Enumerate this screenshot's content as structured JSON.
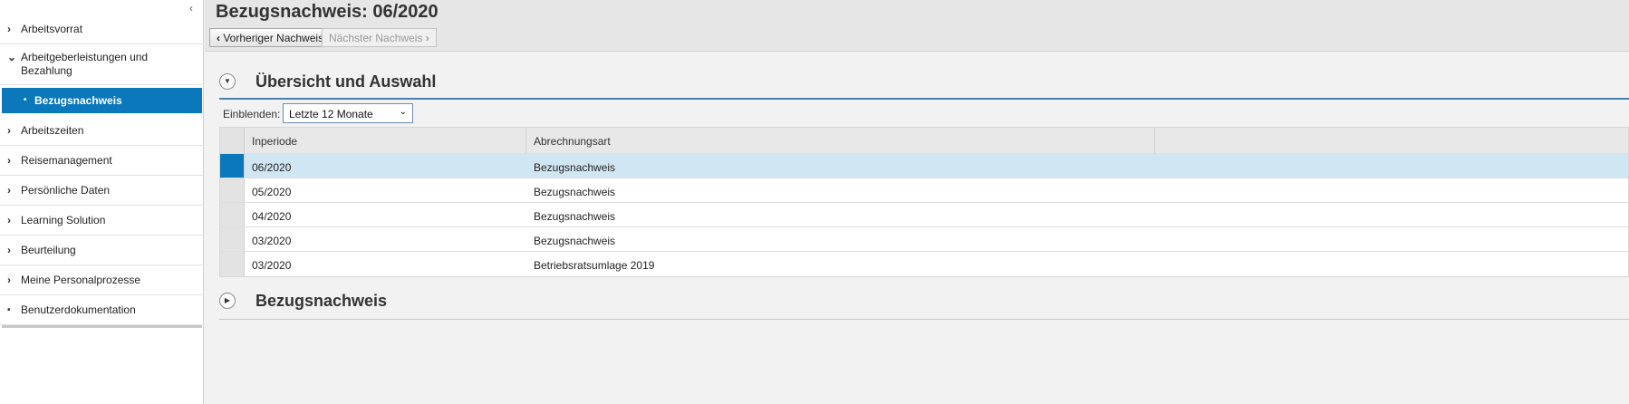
{
  "sidebar": {
    "collapse_icon": "chevron-left-icon",
    "items": [
      {
        "label": "Arbeitsvorrat",
        "icon": "chevron-right-icon"
      },
      {
        "label": "Arbeitgeberleistungen und Bezahlung",
        "icon": "chevron-down-icon"
      },
      {
        "label": "Arbeitszeiten",
        "icon": "chevron-right-icon"
      },
      {
        "label": "Reisemanagement",
        "icon": "chevron-right-icon"
      },
      {
        "label": "Persönliche Daten",
        "icon": "chevron-right-icon"
      },
      {
        "label": "Learning Solution",
        "icon": "chevron-right-icon"
      },
      {
        "label": "Beurteilung",
        "icon": "chevron-right-icon"
      },
      {
        "label": "Meine Personalprozesse",
        "icon": "chevron-right-icon"
      },
      {
        "label": "Benutzerdokumentation",
        "icon": "bullet-icon"
      }
    ],
    "subitem": {
      "label": "Bezugsnachweis",
      "icon": "bullet-icon"
    }
  },
  "header": {
    "title": "Bezugsnachweis: 06/2020",
    "prev_label": "Vorheriger Nachweis",
    "next_label": "Nächster Nachweis"
  },
  "overview": {
    "title": "Übersicht und Auswahl",
    "filter_label": "Einblenden:",
    "filter_value": "Letzte 12 Monate",
    "columns": [
      "Inperiode",
      "Abrechnungsart"
    ],
    "rows": [
      {
        "period": "06/2020",
        "type": "Bezugsnachweis",
        "selected": true
      },
      {
        "period": "05/2020",
        "type": "Bezugsnachweis",
        "selected": false
      },
      {
        "period": "04/2020",
        "type": "Bezugsnachweis",
        "selected": false
      },
      {
        "period": "03/2020",
        "type": "Bezugsnachweis",
        "selected": false
      },
      {
        "period": "03/2020",
        "type": "Betriebsratsumlage 2019",
        "selected": false
      }
    ]
  },
  "detail": {
    "title": "Bezugsnachweis"
  },
  "colors": {
    "accent": "#0a78bb",
    "selected_row": "#d1e6f3"
  }
}
